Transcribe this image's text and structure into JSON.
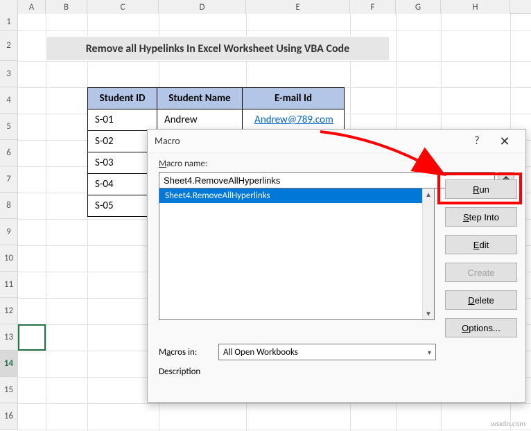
{
  "columns": [
    "A",
    "B",
    "C",
    "D",
    "E",
    "F",
    "G",
    "H"
  ],
  "rows": [
    "1",
    "2",
    "3",
    "4",
    "5",
    "6",
    "7",
    "8",
    "9",
    "10",
    "11",
    "12",
    "13",
    "14",
    "15",
    "16"
  ],
  "selected_row": "14",
  "title": "Remove all Hypelinks In Excel Worksheet Using VBA Code",
  "table": {
    "headers": {
      "c": "Student ID",
      "d": "Student Name",
      "e": "E-mail Id"
    },
    "rows": [
      {
        "c": "S-01",
        "d": "Andrew",
        "e": "Andrew@789.com"
      },
      {
        "c": "S-02",
        "d": "",
        "e": ""
      },
      {
        "c": "S-03",
        "d": "",
        "e": ""
      },
      {
        "c": "S-04",
        "d": "",
        "e": ""
      },
      {
        "c": "S-05",
        "d": "",
        "e": ""
      }
    ]
  },
  "dialog": {
    "title": "Macro",
    "macro_name_label": "Macro name:",
    "macro_name_value": "Sheet4.RemoveAllHyperlinks",
    "macro_list_item": "Sheet4.RemoveAllHyperlinks",
    "macros_in_label": "Macros in:",
    "macros_in_value": "All Open Workbooks",
    "description_label": "Description",
    "buttons": {
      "run": "Run",
      "step_into": "Step Into",
      "edit": "Edit",
      "create": "Create",
      "delete": "Delete",
      "options": "Options..."
    },
    "help": "?",
    "close": "✕"
  },
  "watermark": "wsxdn.com"
}
